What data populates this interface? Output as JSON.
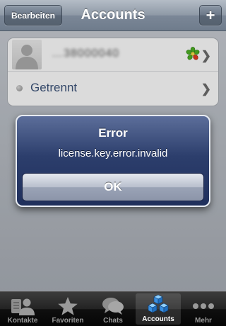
{
  "navbar": {
    "title": "Accounts",
    "edit_label": "Bearbeiten",
    "add_label": "+"
  },
  "accounts": {
    "account_name": "…38000040",
    "account_icon": "icq-flower-icon",
    "status_label": "Getrennt",
    "status_color": "#9a9a9a"
  },
  "alert": {
    "title": "Error",
    "message": "license.key.error.invalid",
    "ok_label": "OK"
  },
  "tabbar": {
    "selected": "Accounts",
    "tabs": [
      {
        "label": "Kontakte",
        "icon": "contacts-icon"
      },
      {
        "label": "Favoriten",
        "icon": "star-icon"
      },
      {
        "label": "Chats",
        "icon": "chat-bubble-icon"
      },
      {
        "label": "Accounts",
        "icon": "accounts-cubes-icon"
      },
      {
        "label": "Mehr",
        "icon": "more-dots-icon"
      }
    ]
  },
  "colors": {
    "accent_blue": "#3c5278",
    "alert_bg": "#2c3e6c",
    "icq_green": "#4caf23",
    "icq_red": "#e23a1f"
  }
}
